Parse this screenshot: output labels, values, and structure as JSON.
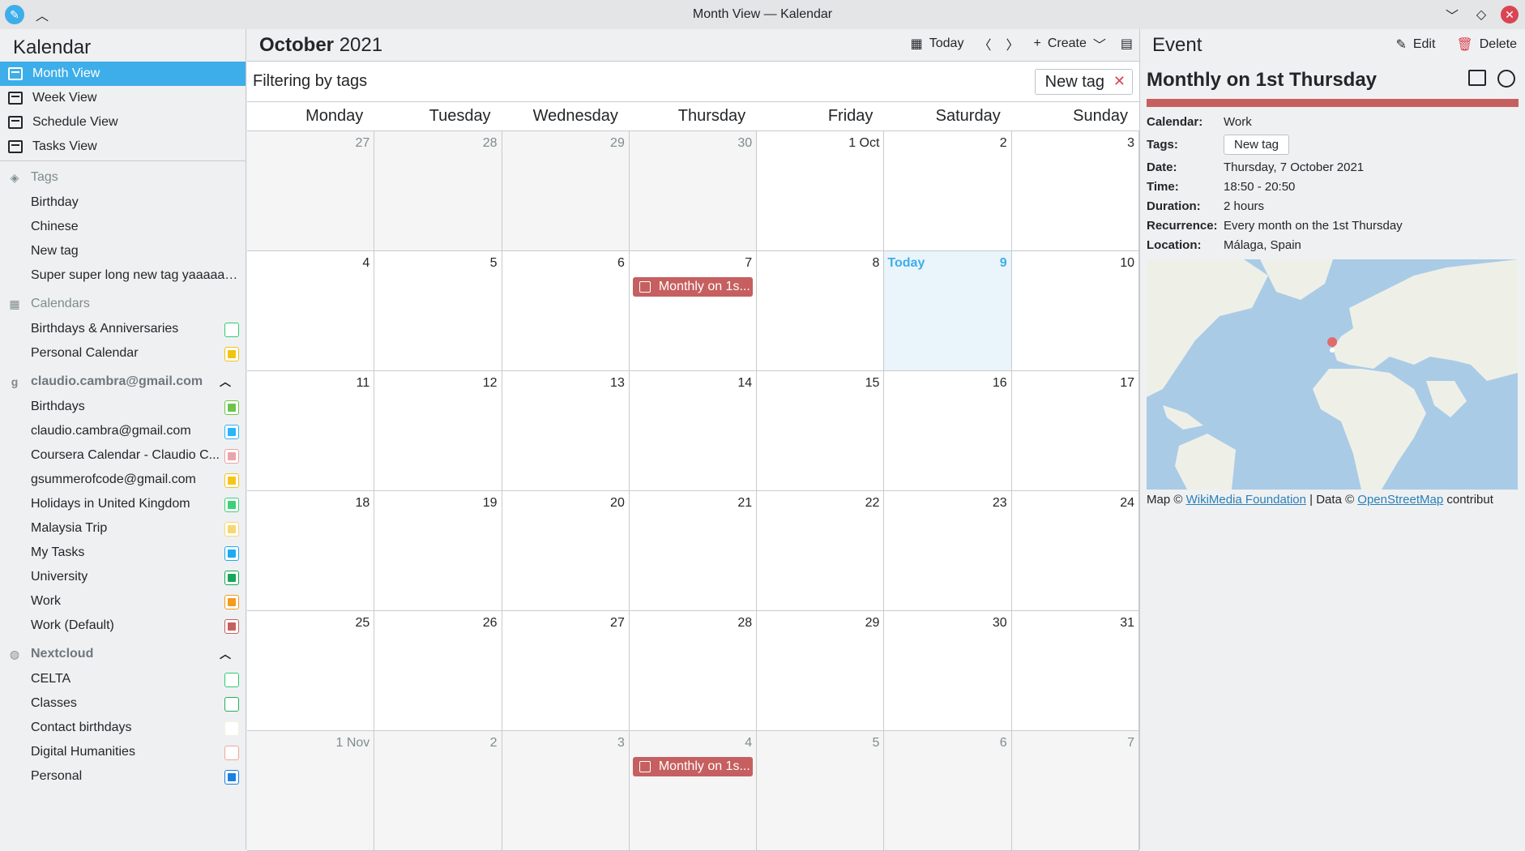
{
  "window": {
    "title": "Month View — Kalendar"
  },
  "sidebar": {
    "app_title": "Kalendar",
    "views": [
      {
        "label": "Month View",
        "active": true
      },
      {
        "label": "Week View"
      },
      {
        "label": "Schedule View"
      },
      {
        "label": "Tasks View"
      }
    ],
    "tags_header": "Tags",
    "tags": [
      "Birthday",
      "Chinese",
      "New tag",
      "Super super long new tag yaaaaaa..."
    ],
    "calendars_header": "Calendars",
    "local_calendars": [
      {
        "label": "Birthdays & Anniversaries",
        "color": "#2ecc71",
        "outline": true
      },
      {
        "label": "Personal Calendar",
        "color": "#f1c40f"
      }
    ],
    "google_header": "claudio.cambra@gmail.com",
    "google_calendars": [
      {
        "label": "Birthdays",
        "color": "#6dc44a"
      },
      {
        "label": "claudio.cambra@gmail.com",
        "color": "#29b6f6"
      },
      {
        "label": "Coursera Calendar - Claudio C...",
        "color": "#e8a5ab"
      },
      {
        "label": "gsummerofcode@gmail.com",
        "color": "#f5c518"
      },
      {
        "label": "Holidays in United Kingdom",
        "color": "#3dd07a"
      },
      {
        "label": "Malaysia Trip",
        "color": "#f7d774"
      },
      {
        "label": "My Tasks",
        "color": "#1eaaf1"
      },
      {
        "label": "University",
        "color": "#17a85a"
      },
      {
        "label": "Work",
        "color": "#f39c1f"
      },
      {
        "label": "Work (Default)",
        "color": "#c65f5f"
      }
    ],
    "nextcloud_header": "Nextcloud",
    "nextcloud_calendars": [
      {
        "label": "CELTA",
        "color": "#2ecc71",
        "outline": true
      },
      {
        "label": "Classes",
        "color": "#27ae60",
        "outline": true
      },
      {
        "label": "Contact birthdays",
        "color": "#f0f4e0",
        "outline": true
      },
      {
        "label": "Digital Humanities",
        "color": "#f0a89a",
        "outline": true
      },
      {
        "label": "Personal",
        "color": "#1d7fe0"
      }
    ]
  },
  "main": {
    "month_bold": "October",
    "year": "2021",
    "today_label": "Today",
    "create_label": "Create",
    "filter_label": "Filtering by tags",
    "filter_tag": "New tag",
    "weekdays": [
      "Monday",
      "Tuesday",
      "Wednesday",
      "Thursday",
      "Friday",
      "Saturday",
      "Sunday"
    ],
    "weeks": [
      [
        {
          "n": "27",
          "o": 1
        },
        {
          "n": "28",
          "o": 1
        },
        {
          "n": "29",
          "o": 1
        },
        {
          "n": "30",
          "o": 1
        },
        {
          "n": "1 Oct"
        },
        {
          "n": "2"
        },
        {
          "n": "3"
        }
      ],
      [
        {
          "n": "4"
        },
        {
          "n": "5"
        },
        {
          "n": "6"
        },
        {
          "n": "7",
          "ev": "Monthly on 1s..."
        },
        {
          "n": "8"
        },
        {
          "n": "9",
          "today": 1
        },
        {
          "n": "10"
        }
      ],
      [
        {
          "n": "11"
        },
        {
          "n": "12"
        },
        {
          "n": "13"
        },
        {
          "n": "14"
        },
        {
          "n": "15"
        },
        {
          "n": "16"
        },
        {
          "n": "17"
        }
      ],
      [
        {
          "n": "18"
        },
        {
          "n": "19"
        },
        {
          "n": "20"
        },
        {
          "n": "21"
        },
        {
          "n": "22"
        },
        {
          "n": "23"
        },
        {
          "n": "24"
        }
      ],
      [
        {
          "n": "25"
        },
        {
          "n": "26"
        },
        {
          "n": "27"
        },
        {
          "n": "28"
        },
        {
          "n": "29"
        },
        {
          "n": "30"
        },
        {
          "n": "31"
        }
      ],
      [
        {
          "n": "1 Nov",
          "o": 1
        },
        {
          "n": "2",
          "o": 1
        },
        {
          "n": "3",
          "o": 1
        },
        {
          "n": "4",
          "o": 1,
          "ev": "Monthly on 1s..."
        },
        {
          "n": "5",
          "o": 1
        },
        {
          "n": "6",
          "o": 1
        },
        {
          "n": "7",
          "o": 1
        }
      ]
    ],
    "today_word": "Today"
  },
  "event_panel": {
    "title": "Event",
    "edit_label": "Edit",
    "delete_label": "Delete",
    "event_title": "Monthly on 1st Thursday",
    "accent_color": "#c65f5f",
    "calendar_key": "Calendar:",
    "calendar": "Work",
    "tags_key": "Tags:",
    "tag": "New tag",
    "date_key": "Date:",
    "date": "Thursday, 7 October 2021",
    "time_key": "Time:",
    "time": "18:50 - 20:50",
    "duration_key": "Duration:",
    "duration": "2 hours",
    "recurrence_key": "Recurrence:",
    "recurrence": "Every month on the 1st Thursday",
    "location_key": "Location:",
    "location": "Málaga, Spain",
    "attr_map": "Map ©",
    "attr_wiki": "WikiMedia Foundation",
    "attr_sep": "| Data ©",
    "attr_osm": "OpenStreetMap",
    "attr_tail": "contribut"
  }
}
